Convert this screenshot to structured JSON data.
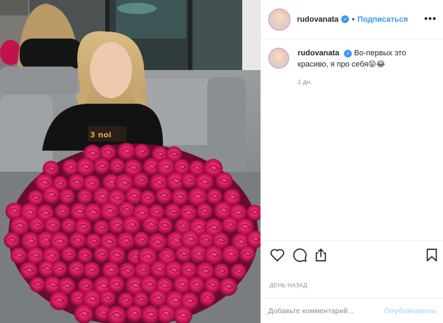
{
  "post": {
    "image_alt": "",
    "header": {
      "username": "rudovanata",
      "separator": "•",
      "follow_label": "Подписаться",
      "more_icon": "more-icon"
    },
    "caption": {
      "username": "rudovanata",
      "text": "Во-первых это красиво, я про себя😝😂",
      "time": "1 дн."
    },
    "actions": {
      "like_icon": "heart-icon",
      "comment_icon": "comment-icon",
      "share_icon": "share-icon",
      "save_icon": "bookmark-icon"
    },
    "date_label": "ДЕНЬ НАЗАД",
    "comment_box": {
      "placeholder": "Добавьте комментарий...",
      "publish_label": "Опубликовать"
    },
    "colors": {
      "accent": "#3897f0",
      "publish_disabled": "#b2dffc",
      "muted": "#8e8e8e"
    }
  }
}
